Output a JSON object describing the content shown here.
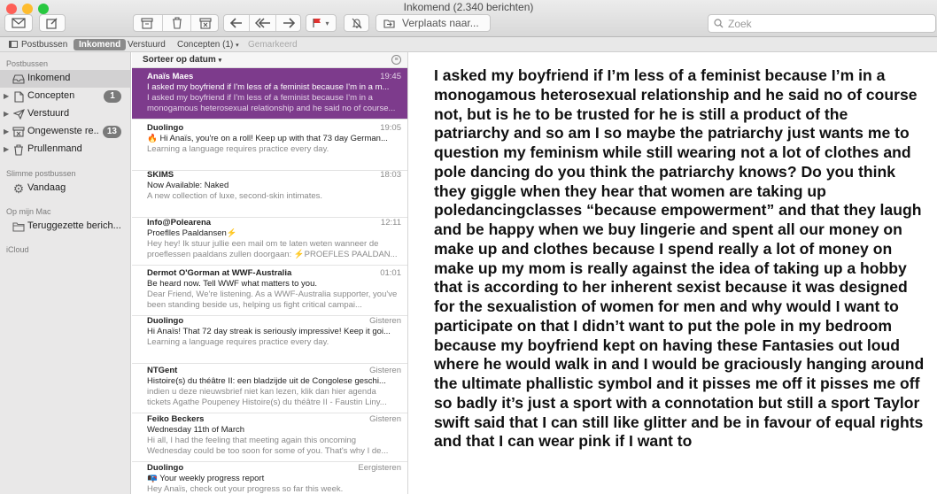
{
  "window": {
    "title": "Inkomend (2.340 berichten)",
    "move_label": "Verplaats naar...",
    "search_placeholder": "Zoek"
  },
  "favorites": {
    "mailboxes": "Postbussen",
    "inbox": "Inkomend",
    "sent": "Verstuurd",
    "drafts": "Concepten (1)",
    "flagged": "Gemarkeerd"
  },
  "sidebar": {
    "section_mailboxes": "Postbussen",
    "items": [
      {
        "label": "Inkomend",
        "badge": ""
      },
      {
        "label": "Concepten",
        "badge": "1"
      },
      {
        "label": "Verstuurd",
        "badge": ""
      },
      {
        "label": "Ongewenste re...",
        "badge": "13"
      },
      {
        "label": "Prullenmand",
        "badge": ""
      }
    ],
    "section_smart": "Slimme postbussen",
    "smart_today": "Vandaag",
    "section_mac": "Op mijn Mac",
    "mac_recovered": "Teruggezette berich...",
    "section_icloud": "iCloud"
  },
  "list": {
    "sort_label": "Sorteer op datum",
    "messages": [
      {
        "from": "Anaïs Maes",
        "time": "19:45",
        "subject": "I asked my boyfriend if I'm less of a feminist because I'm in a m...",
        "preview": "I asked my boyfriend if I'm less of a feminist because I'm in a monogamous heterosexual relationship and he said no of course..."
      },
      {
        "from": "Duolingo",
        "time": "19:05",
        "subject": "🔥 Hi Anaïs, you're on a roll! Keep up with that 73 day German...",
        "preview": "Learning a language requires practice every day."
      },
      {
        "from": "SKIMS",
        "time": "18:03",
        "subject": "Now Available: Naked",
        "preview": "A new collection of luxe, second-skin intimates."
      },
      {
        "from": "Info@Polearena",
        "time": "12:11",
        "subject": "Proeflles Paaldansen⚡",
        "preview": "Hey hey! Ik stuur jullie een mail om te laten weten wanneer de proeflessen paaldans zullen doorgaan: ⚡PROEFLES PAALDAN..."
      },
      {
        "from": "Dermot O'Gorman at WWF-Australia",
        "time": "01:01",
        "subject": "Be heard now. Tell WWF what matters to you.",
        "preview": "Dear Friend, We're listening. As a WWF-Australia supporter, you've been standing beside us, helping us fight critical campai..."
      },
      {
        "from": "Duolingo",
        "time": "Gisteren",
        "subject": "Hi Anaïs! That 72 day streak is seriously impressive! Keep it goi...",
        "preview": "Learning a language requires practice every day."
      },
      {
        "from": "NTGent",
        "time": "Gisteren",
        "subject": "Histoire(s) du théâtre II: een bladzijde uit de Congolese geschi...",
        "preview": "indien u deze nieuwsbrief niet kan lezen, klik dan hier agenda tickets Agathe Poupeney Histoire(s) du théâtre II - Faustin Liny..."
      },
      {
        "from": "Feiko Beckers",
        "time": "Gisteren",
        "subject": "Wednesday 11th of March",
        "preview": "Hi all, I had the feeling that meeting again this oncoming Wednesday could be too soon for some of you. That's why I de..."
      },
      {
        "from": "Duolingo",
        "time": "Eergisteren",
        "subject": "📭 Your weekly progress report",
        "preview": "Hey Anaïs, check out your progress so far this week."
      }
    ]
  },
  "reading": {
    "body": "I asked my boyfriend if I’m less of a feminist because I’m in a monogamous heterosexual relationship and he said no of course not, but is he to be trusted for he is still a product of the patriarchy and so am I so maybe the patriarchy just wants me to question my feminism while still wearing not a lot of clothes and pole dancing do you think the patriarchy knows? Do you think they giggle when they hear that women are taking up poledancingclasses “because empowerment” and that they laugh and be happy when we buy lingerie and spent all our money on make up and clothes because I spend really a lot of money on make up my mom is really against the idea of taking up a hobby that is according to her inherent sexist because it was designed for the sexualistion of women for men and why would I want to participate on that I didn’t want to put the pole in my bedroom because my boyfriend kept on having these Fantasies out loud where he would walk in and I would be graciously hanging around the ultimate phallistic symbol and it pisses me off it pisses me off so badly it’s just a sport with a connotation but still a sport Taylor swift said that I can still like glitter and be in favour of equal rights and that I can wear pink if I want to"
  },
  "colors": {
    "selection": "#7d3b8c",
    "close": "#fe5f57",
    "minimize": "#febc2e",
    "zoom": "#28c840",
    "flag": "#e0322f"
  }
}
